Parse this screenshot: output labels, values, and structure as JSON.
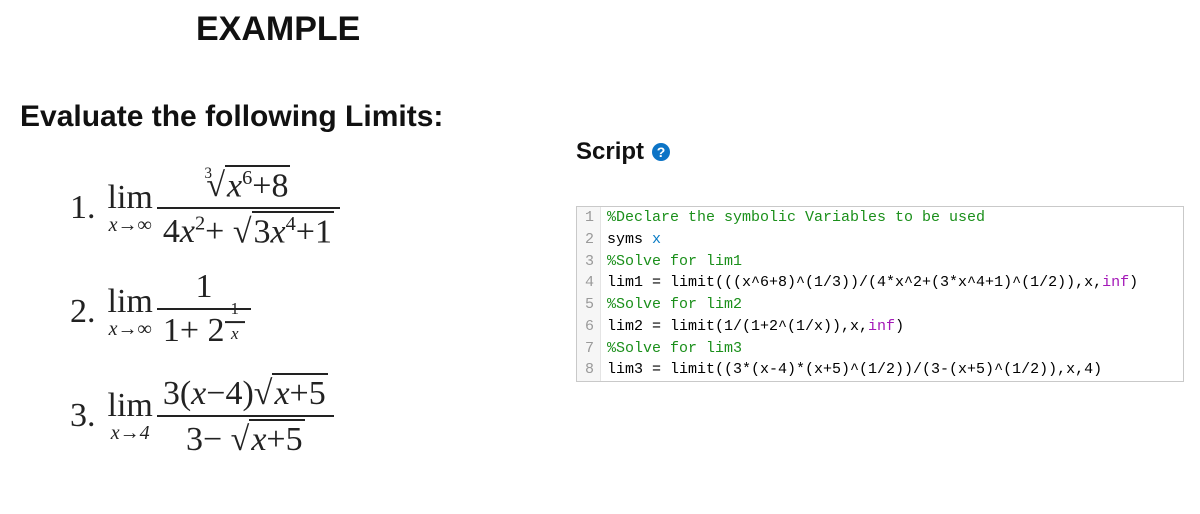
{
  "heading": "EXAMPLE",
  "subheading": "Evaluate the following Limits:",
  "problems": [
    {
      "index": "1.",
      "lim_top": "lim",
      "lim_sub_pre": "x→∞",
      "numerator_rootindex": "3",
      "numerator_radicand_run": [
        {
          "t": "x",
          "i": true
        },
        {
          "t": "6",
          "sup": true
        },
        {
          "t": "+8"
        }
      ],
      "denominator_pre_run": [
        {
          "t": "4"
        },
        {
          "t": "x",
          "i": true
        },
        {
          "t": "2",
          "sup": true
        },
        {
          "t": "+ "
        }
      ],
      "denominator_radicand_run": [
        {
          "t": "3"
        },
        {
          "t": "x",
          "i": true
        },
        {
          "t": "4",
          "sup": true
        },
        {
          "t": "+1"
        }
      ]
    },
    {
      "index": "2.",
      "lim_top": "lim",
      "lim_sub_pre": "x→∞",
      "numerator_plain": "1",
      "denominator_pre_run": [
        {
          "t": "1+ 2"
        }
      ],
      "denominator_exp_frac": {
        "nu": "1",
        "de_run": [
          {
            "t": "x",
            "i": true
          }
        ]
      }
    },
    {
      "index": "3.",
      "lim_top": "lim",
      "lim_sub_pre": "x→4",
      "numerator_pre_run": [
        {
          "t": "3("
        },
        {
          "t": "x",
          "i": true
        },
        {
          "t": "−4)"
        }
      ],
      "numerator_radicand_run": [
        {
          "t": "x",
          "i": true
        },
        {
          "t": "+5"
        }
      ],
      "denominator_pre_run": [
        {
          "t": "3− "
        }
      ],
      "denominator_radicand_run": [
        {
          "t": "x",
          "i": true
        },
        {
          "t": "+5"
        }
      ]
    }
  ],
  "script_label": "Script",
  "help_glyph": "?",
  "code": [
    {
      "n": "1",
      "tokens": [
        {
          "c": "comment",
          "t": "%Declare the symbolic Variables to be used"
        }
      ]
    },
    {
      "n": "2",
      "tokens": [
        {
          "c": "kw",
          "t": "syms "
        },
        {
          "c": "var",
          "t": "x"
        }
      ]
    },
    {
      "n": "3",
      "tokens": [
        {
          "c": "comment",
          "t": "%Solve for lim1"
        }
      ]
    },
    {
      "n": "4",
      "tokens": [
        {
          "c": "kw",
          "t": "lim1 = limit(((x^6+8)^(1/3))/(4*x^2+(3*x^4+1)^(1/2)),x,"
        },
        {
          "c": "kw2",
          "t": "inf"
        },
        {
          "c": "kw",
          "t": ")"
        }
      ]
    },
    {
      "n": "5",
      "tokens": [
        {
          "c": "comment",
          "t": "%Solve for lim2"
        }
      ]
    },
    {
      "n": "6",
      "tokens": [
        {
          "c": "kw",
          "t": "lim2 = limit(1/(1+2^(1/x)),x,"
        },
        {
          "c": "kw2",
          "t": "inf"
        },
        {
          "c": "kw",
          "t": ")"
        }
      ]
    },
    {
      "n": "7",
      "tokens": [
        {
          "c": "comment",
          "t": "%Solve for lim3"
        }
      ]
    },
    {
      "n": "8",
      "tokens": [
        {
          "c": "kw",
          "t": "lim3 = limit((3*(x-4)*(x+5)^(1/2))/(3-(x+5)^(1/2)),x,4)"
        }
      ]
    }
  ]
}
